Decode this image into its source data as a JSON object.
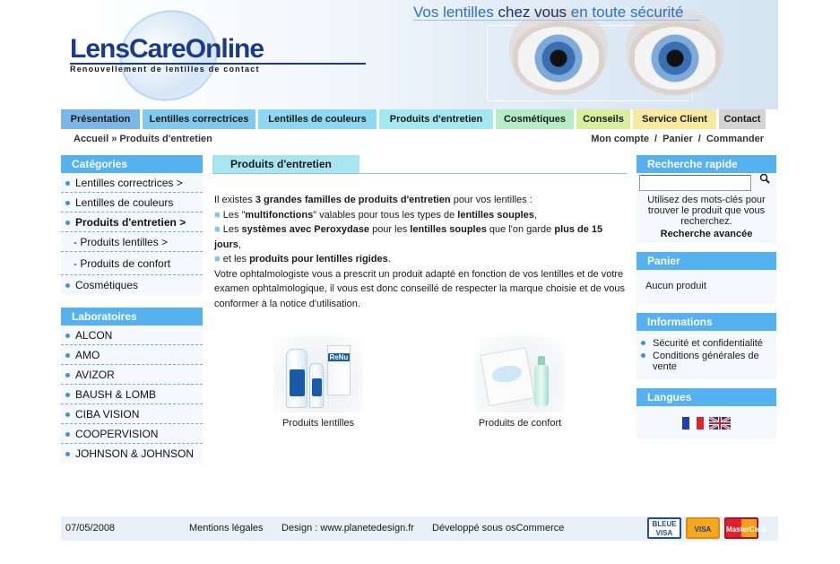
{
  "header": {
    "logo_text": "LensCareOnline",
    "subtitle": "Renouvellement de lentilles de contact",
    "tagline_a": "Vos lentilles",
    "tagline_b": " chez vous ",
    "tagline_c": "en toute sécurité"
  },
  "nav": [
    {
      "label": "Présentation",
      "color": "#7fb6e8",
      "width": 88
    },
    {
      "label": "Lentilles correctrices",
      "color": "#82c9ee",
      "width": 126
    },
    {
      "label": "Lentilles de couleurs",
      "color": "#8fd8f2",
      "width": 132
    },
    {
      "label": "Produits d'entretien",
      "color": "#a2e8ee",
      "width": 127
    },
    {
      "label": "Cosmétiques",
      "color": "#b5ecc7",
      "width": 87
    },
    {
      "label": "Conseils",
      "color": "#d9ee9f",
      "width": 60
    },
    {
      "label": "Service Client",
      "color": "#fae9a1",
      "width": 93
    },
    {
      "label": "Contact",
      "color": "#d4d4d4",
      "width": 52
    }
  ],
  "breadcrumb": {
    "home": "Accueil",
    "sep": " » ",
    "current": "Produits d'entretien"
  },
  "account": {
    "my_account": "Mon compte",
    "cart": "Panier",
    "checkout": "Commander",
    "sep": "/"
  },
  "categories": {
    "title": "Catégories",
    "items": [
      {
        "label": "Lentilles correctrices >",
        "type": "top"
      },
      {
        "label": "Lentilles de couleurs",
        "type": "top"
      },
      {
        "label": "Produits d'entretien >",
        "type": "active"
      },
      {
        "label": "-  Produits lentilles >",
        "type": "sub"
      },
      {
        "label": "-  Produits de confort",
        "type": "sub2"
      },
      {
        "label": "Cosmétiques",
        "type": "top"
      }
    ]
  },
  "labs": {
    "title": "Laboratoires",
    "items": [
      "ALCON",
      "AMO",
      "AVIZOR",
      "BAUSH & LOMB",
      "CIBA VISION",
      "COOPERVISION",
      "JOHNSON & JOHNSON"
    ]
  },
  "center": {
    "tab_title": "Produits d'entretien",
    "p1a": "Il existes ",
    "p1b": "3 grandes familles de produits d'entretien",
    "p1c": " pour vos lentilles :",
    "b1a": "Les \"",
    "b1b": "multifonctions",
    "b1c": "\" valables pour tous les types de ",
    "b1d": "lentilles souples",
    "b1e": ",",
    "b2a": "Les ",
    "b2b": "systèmes avec Peroxydase",
    "b2c": " pour les ",
    "b2d": "lentilles souples",
    "b2e": " que l'on garde ",
    "b2f": "plus de 15 jours",
    "b2g": ",",
    "b3a": " et les ",
    "b3b": "produits pour lentilles rigides",
    "b3c": ".",
    "p2": "Votre ophtalmologiste vous a prescrit un produit adapté en fonction de vos lentilles et de votre examen ophtalmologique, il vous est donc conseillé de respecter la marque choisie et de vous conformer à la notice d'utilisation.",
    "products": [
      {
        "label": "Produits lentilles"
      },
      {
        "label": "Produits de confort"
      }
    ]
  },
  "quick_search": {
    "title": "Recherche rapide",
    "help": "Utilisez des mots-clés pour trouver le produit que vous recherchez.",
    "advanced": "Recherche avancée"
  },
  "cart_box": {
    "title": "Panier",
    "empty": "Aucun produit"
  },
  "info_box": {
    "title": "Informations",
    "items": [
      "Sécurité et confidentialité",
      "Conditions générales de vente"
    ]
  },
  "lang_box": {
    "title": "Langues"
  },
  "footer": {
    "date": "07/05/2008",
    "legal": "Mentions légales",
    "design": "Design : www.planetedesign.fr",
    "powered": "Développé sous osCommerce",
    "cards": [
      "BLEUE VISA",
      "VISA",
      "MasterCard"
    ]
  },
  "colors": {
    "accent": "#56b1f0",
    "brand": "#1a3a8c",
    "tab_center": "#a7e6ee"
  }
}
